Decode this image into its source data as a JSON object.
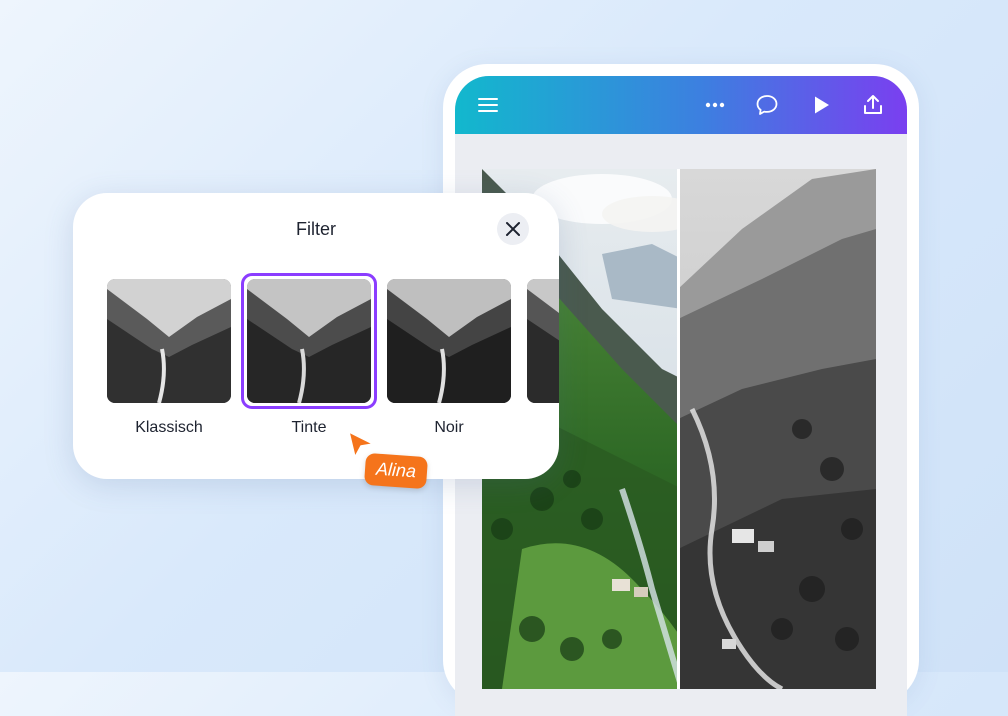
{
  "filter_panel": {
    "title": "Filter",
    "filters": [
      {
        "label": "Klassisch",
        "selected": false
      },
      {
        "label": "Tinte",
        "selected": true
      },
      {
        "label": "Noir",
        "selected": false
      },
      {
        "label": "",
        "selected": false
      }
    ]
  },
  "collaborator": {
    "name": "Alina",
    "color": "#f5741b"
  },
  "toolbar": {
    "icons": [
      "menu-icon",
      "more-icon",
      "comment-icon",
      "play-icon",
      "share-icon"
    ]
  },
  "colors": {
    "accent": "#8b3dff",
    "topbar_start": "#12b8cd",
    "topbar_end": "#7a3ff0"
  }
}
